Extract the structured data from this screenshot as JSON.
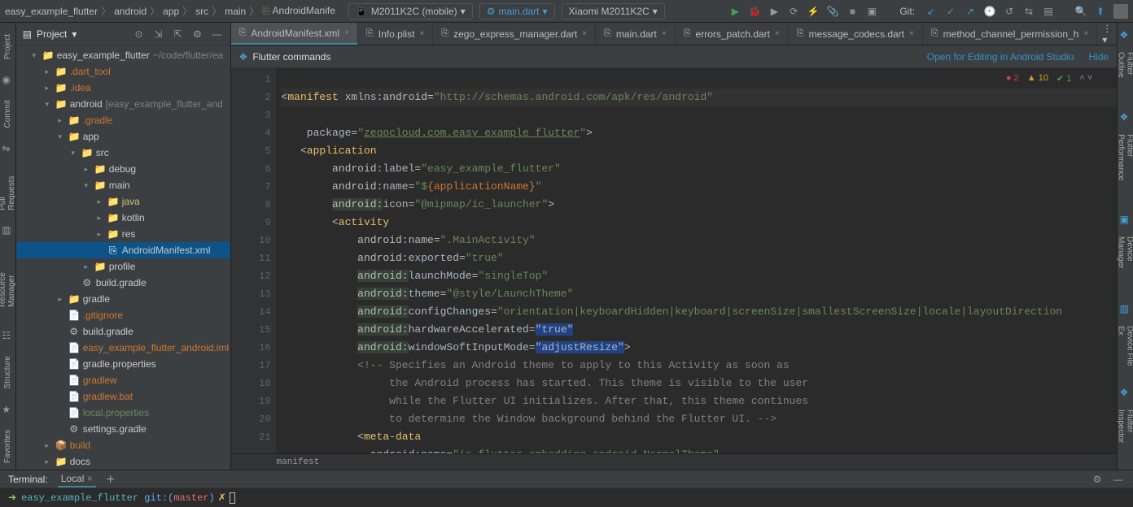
{
  "breadcrumb": [
    "easy_example_flutter",
    "android",
    "app",
    "src",
    "main",
    "AndroidManife"
  ],
  "device_combo": "M2011K2C (mobile)",
  "config_combo": "main.dart",
  "target_combo": "Xiaomi M2011K2C",
  "git_label": "Git:",
  "project": {
    "label": "Project"
  },
  "left_tabs": [
    "Project",
    "Commit",
    "Pull Requests",
    "Resource Manager",
    "Structure",
    "Favorites"
  ],
  "tree": [
    {
      "depth": 0,
      "chv": "v",
      "icon": "folder",
      "name": "easy_example_flutter",
      "suffix": "~/code/flutter/ea",
      "nameClass": "",
      "sel": false
    },
    {
      "depth": 1,
      "chv": ">",
      "icon": "folder",
      "name": ".dart_tool",
      "nameClass": "orange",
      "sel": false
    },
    {
      "depth": 1,
      "chv": ">",
      "icon": "folder",
      "name": ".idea",
      "nameClass": "orange",
      "sel": false
    },
    {
      "depth": 1,
      "chv": "v",
      "icon": "folder",
      "name": "android",
      "suffix": "[easy_example_flutter_and",
      "nameClass": "",
      "sel": false
    },
    {
      "depth": 2,
      "chv": ">",
      "icon": "folder",
      "name": ".gradle",
      "nameClass": "orange",
      "sel": false
    },
    {
      "depth": 2,
      "chv": "v",
      "icon": "folder",
      "name": "app",
      "nameClass": "",
      "sel": false
    },
    {
      "depth": 3,
      "chv": "v",
      "icon": "folder",
      "name": "src",
      "nameClass": "",
      "sel": false
    },
    {
      "depth": 4,
      "chv": ">",
      "icon": "folder",
      "name": "debug",
      "nameClass": "",
      "sel": false
    },
    {
      "depth": 4,
      "chv": "v",
      "icon": "folder",
      "name": "main",
      "nameClass": "",
      "sel": false
    },
    {
      "depth": 5,
      "chv": ">",
      "icon": "folder",
      "name": "java",
      "nameClass": "yellow",
      "sel": false
    },
    {
      "depth": 5,
      "chv": ">",
      "icon": "folder",
      "name": "kotlin",
      "nameClass": "",
      "sel": false
    },
    {
      "depth": 5,
      "chv": ">",
      "icon": "folder",
      "name": "res",
      "nameClass": "",
      "sel": false
    },
    {
      "depth": 5,
      "chv": " ",
      "icon": "xml",
      "name": "AndroidManifest.xml",
      "nameClass": "",
      "sel": true
    },
    {
      "depth": 4,
      "chv": ">",
      "icon": "folder",
      "name": "profile",
      "nameClass": "",
      "sel": false
    },
    {
      "depth": 3,
      "chv": " ",
      "icon": "gradle",
      "name": "build.gradle",
      "nameClass": "",
      "sel": false
    },
    {
      "depth": 2,
      "chv": ">",
      "icon": "folder",
      "name": "gradle",
      "nameClass": "",
      "sel": false
    },
    {
      "depth": 2,
      "chv": " ",
      "icon": "file",
      "name": ".gitignore",
      "nameClass": "orange",
      "sel": false
    },
    {
      "depth": 2,
      "chv": " ",
      "icon": "gradle",
      "name": "build.gradle",
      "nameClass": "",
      "sel": false
    },
    {
      "depth": 2,
      "chv": " ",
      "icon": "file",
      "name": "easy_example_flutter_android.iml",
      "nameClass": "orange",
      "sel": false
    },
    {
      "depth": 2,
      "chv": " ",
      "icon": "file",
      "name": "gradle.properties",
      "nameClass": "",
      "sel": false
    },
    {
      "depth": 2,
      "chv": " ",
      "icon": "file",
      "name": "gradlew",
      "nameClass": "orange",
      "sel": false
    },
    {
      "depth": 2,
      "chv": " ",
      "icon": "file",
      "name": "gradlew.bat",
      "nameClass": "orange",
      "sel": false
    },
    {
      "depth": 2,
      "chv": " ",
      "icon": "file",
      "name": "local.properties",
      "nameClass": "green",
      "sel": false
    },
    {
      "depth": 2,
      "chv": " ",
      "icon": "gradle",
      "name": "settings.gradle",
      "nameClass": "",
      "sel": false
    },
    {
      "depth": 1,
      "chv": ">",
      "icon": "folder-pkg",
      "name": "build",
      "nameClass": "orange",
      "sel": false
    },
    {
      "depth": 1,
      "chv": ">",
      "icon": "folder",
      "name": "docs",
      "nameClass": "",
      "sel": false
    }
  ],
  "tabs": [
    {
      "label": "AndroidManifest.xml",
      "icon": "xml",
      "active": true
    },
    {
      "label": "Info.plist",
      "icon": "plist",
      "active": false
    },
    {
      "label": "zego_express_manager.dart",
      "icon": "dart",
      "active": false
    },
    {
      "label": "main.dart",
      "icon": "dart",
      "active": false
    },
    {
      "label": "errors_patch.dart",
      "icon": "dart",
      "active": false
    },
    {
      "label": "message_codecs.dart",
      "icon": "dart",
      "active": false
    },
    {
      "label": "method_channel_permission_h",
      "icon": "dart",
      "active": false
    }
  ],
  "banner": {
    "cmd": "Flutter commands",
    "link1": "Open for Editing in Android Studio",
    "link2": "Hide"
  },
  "right_tabs": [
    "Flutter Outline",
    "Flutter Performance",
    "Device Manager",
    "Device File Ex",
    "Flutter Inspector"
  ],
  "errs": {
    "err": "2",
    "warn": "10",
    "ok": "1"
  },
  "gutter_lines": [
    "1",
    "2",
    "3",
    "4",
    "5",
    "6",
    "7",
    "8",
    "9",
    "10",
    "11",
    "12",
    "13",
    "14",
    "15",
    "16",
    "17",
    "18",
    "19",
    "20",
    "21"
  ],
  "crumb": "manifest",
  "terminal": {
    "title": "Terminal:",
    "tab": "Local",
    "prompt_arrow": "➜",
    "path": "easy_example_flutter",
    "git": "git:(",
    "branch": "master",
    "close": ")",
    "x": "✗"
  }
}
